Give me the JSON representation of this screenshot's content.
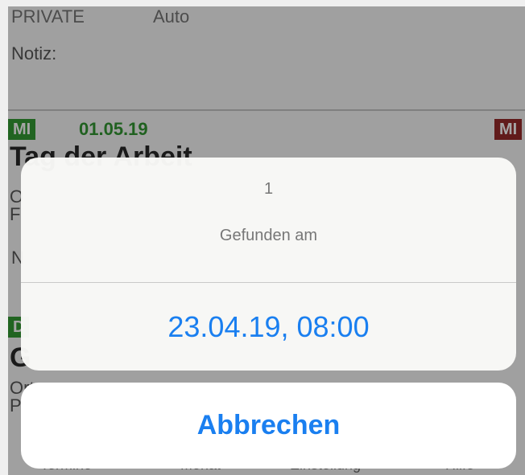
{
  "background": {
    "row1_left": "PRIVATE",
    "row1_right": "Auto",
    "note_label": "Notiz:",
    "entry1": {
      "day": "MI",
      "date": "01.05.19",
      "title": "Tag der Arbeit",
      "right_day": "MI",
      "line_a": "O",
      "line_b": "F",
      "note_initial": "N"
    },
    "entry2": {
      "day": "D",
      "title_initial": "G",
      "line_a": "Ort",
      "line_b": "P"
    },
    "tabs": [
      "Termine",
      "Monat",
      "Einstellung",
      "Hilfe"
    ]
  },
  "action_sheet": {
    "number": "1",
    "message": "Gefunden am",
    "action_label": "23.04.19, 08:00",
    "cancel_label": "Abbrechen"
  },
  "colors": {
    "accent_blue": "#1a7ff0",
    "green_badge": "#1c8f1c",
    "red_badge": "#8b1212"
  }
}
